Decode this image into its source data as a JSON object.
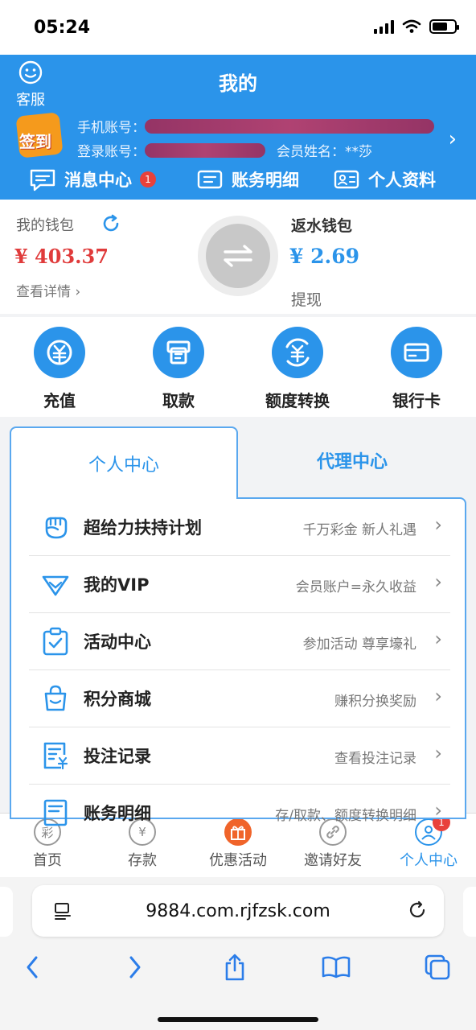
{
  "status_bar": {
    "time": "05:24"
  },
  "header": {
    "title": "我的",
    "customer_service": "客服",
    "signin": "签到",
    "phone_label": "手机账号：",
    "login_label": "登录账号：",
    "member_label": "会员姓名：",
    "member_name": "**莎",
    "quick_links": [
      {
        "label": "消息中心",
        "badge": "1",
        "icon": "message-icon"
      },
      {
        "label": "账务明细",
        "icon": "ledger-icon"
      },
      {
        "label": "个人资料",
        "icon": "profile-card-icon"
      }
    ]
  },
  "wallet": {
    "my_wallet_label": "我的钱包",
    "my_wallet_amount": "¥ 403.37",
    "view_details": "查看详情",
    "rebate_label": "返水钱包",
    "rebate_amount": "¥ 2.69",
    "withdraw": "提现"
  },
  "actions": [
    {
      "label": "充值",
      "icon": "recharge-icon"
    },
    {
      "label": "取款",
      "icon": "withdraw-atm-icon"
    },
    {
      "label": "额度转换",
      "icon": "transfer-icon"
    },
    {
      "label": "银行卡",
      "icon": "bank-card-icon"
    }
  ],
  "tabs": {
    "personal": "个人中心",
    "agent": "代理中心"
  },
  "menu": [
    {
      "title": "超给力扶持计划",
      "subtitle": "千万彩金 新人礼遇",
      "icon": "fist-icon"
    },
    {
      "title": "我的VIP",
      "subtitle": "会员账户=永久收益",
      "icon": "vip-diamond-icon"
    },
    {
      "title": "活动中心",
      "subtitle": "参加活动 尊享壕礼",
      "icon": "clipboard-check-icon"
    },
    {
      "title": "积分商城",
      "subtitle": "赚积分换奖励",
      "icon": "shopping-bag-icon"
    },
    {
      "title": "投注记录",
      "subtitle": "查看投注记录",
      "icon": "bet-record-icon"
    },
    {
      "title": "账务明细",
      "subtitle": "存/取款、额度转换明细",
      "icon": "ledger-list-icon"
    }
  ],
  "tabbar": [
    {
      "label": "首页",
      "glyph": "彩"
    },
    {
      "label": "存款",
      "glyph": "¥"
    },
    {
      "label": "优惠活动",
      "glyph": ""
    },
    {
      "label": "邀请好友",
      "glyph": ""
    },
    {
      "label": "个人中心",
      "glyph": "",
      "badge": "1"
    }
  ],
  "browser": {
    "url": "9884.com.rjfzsk.com"
  },
  "colors": {
    "primary": "#2b94ea",
    "amount_red": "#e03b3b",
    "badge_red": "#e8413b",
    "gift_orange": "#f0642a"
  }
}
